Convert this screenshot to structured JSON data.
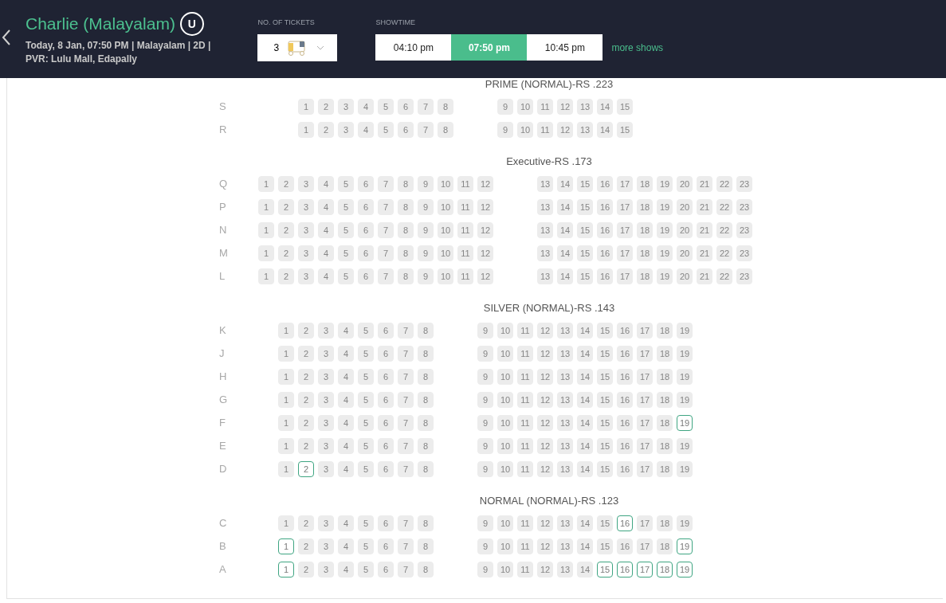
{
  "header": {
    "title": "Charlie (Malayalam)",
    "certificate": "U",
    "details_line1": "Today, 8 Jan, 07:50 PM | Malayalam | 2D |",
    "details_line2": "PVR: Lulu Mall, Edapally",
    "tickets": {
      "label": "NO. OF TICKETS",
      "value": "3"
    },
    "showtime": {
      "label": "SHOWTIME",
      "times": [
        {
          "label": "04:10 pm",
          "selected": false
        },
        {
          "label": "07:50 pm",
          "selected": true
        },
        {
          "label": "10:45 pm",
          "selected": false
        }
      ],
      "more_link": "more shows"
    }
  },
  "sections": [
    {
      "title": "PRIME (NORMAL)-RS .223",
      "rows": [
        {
          "label": "S",
          "blocks": [
            [
              {
                "n": "1",
                "available": false
              },
              {
                "n": "2",
                "available": false
              },
              {
                "n": "3",
                "available": false
              },
              {
                "n": "4",
                "available": false
              },
              {
                "n": "5",
                "available": false
              },
              {
                "n": "6",
                "available": false
              },
              {
                "n": "7",
                "available": false
              },
              {
                "n": "8",
                "available": false
              }
            ],
            [
              {
                "n": "9",
                "available": false
              },
              {
                "n": "10",
                "available": false
              },
              {
                "n": "11",
                "available": false
              },
              {
                "n": "12",
                "available": false
              },
              {
                "n": "13",
                "available": false
              },
              {
                "n": "14",
                "available": false
              },
              {
                "n": "15",
                "available": false
              }
            ]
          ]
        },
        {
          "label": "R",
          "blocks": [
            [
              {
                "n": "1",
                "available": false
              },
              {
                "n": "2",
                "available": false
              },
              {
                "n": "3",
                "available": false
              },
              {
                "n": "4",
                "available": false
              },
              {
                "n": "5",
                "available": false
              },
              {
                "n": "6",
                "available": false
              },
              {
                "n": "7",
                "available": false
              },
              {
                "n": "8",
                "available": false
              }
            ],
            [
              {
                "n": "9",
                "available": false
              },
              {
                "n": "10",
                "available": false
              },
              {
                "n": "11",
                "available": false
              },
              {
                "n": "12",
                "available": false
              },
              {
                "n": "13",
                "available": false
              },
              {
                "n": "14",
                "available": false
              },
              {
                "n": "15",
                "available": false
              }
            ]
          ]
        }
      ]
    },
    {
      "title": "Executive-RS .173",
      "rows": [
        {
          "label": "Q",
          "blocks": [
            [
              {
                "n": "1",
                "available": false
              },
              {
                "n": "2",
                "available": false
              },
              {
                "n": "3",
                "available": false
              },
              {
                "n": "4",
                "available": false
              },
              {
                "n": "5",
                "available": false
              },
              {
                "n": "6",
                "available": false
              },
              {
                "n": "7",
                "available": false
              },
              {
                "n": "8",
                "available": false
              },
              {
                "n": "9",
                "available": false
              },
              {
                "n": "10",
                "available": false
              },
              {
                "n": "11",
                "available": false
              },
              {
                "n": "12",
                "available": false
              }
            ],
            [
              {
                "n": "13",
                "available": false
              },
              {
                "n": "14",
                "available": false
              },
              {
                "n": "15",
                "available": false
              },
              {
                "n": "16",
                "available": false
              },
              {
                "n": "17",
                "available": false
              },
              {
                "n": "18",
                "available": false
              },
              {
                "n": "19",
                "available": false
              },
              {
                "n": "20",
                "available": false
              },
              {
                "n": "21",
                "available": false
              },
              {
                "n": "22",
                "available": false
              },
              {
                "n": "23",
                "available": false
              }
            ]
          ]
        },
        {
          "label": "P",
          "blocks": [
            [
              {
                "n": "1",
                "available": false
              },
              {
                "n": "2",
                "available": false
              },
              {
                "n": "3",
                "available": false
              },
              {
                "n": "4",
                "available": false
              },
              {
                "n": "5",
                "available": false
              },
              {
                "n": "6",
                "available": false
              },
              {
                "n": "7",
                "available": false
              },
              {
                "n": "8",
                "available": false
              },
              {
                "n": "9",
                "available": false
              },
              {
                "n": "10",
                "available": false
              },
              {
                "n": "11",
                "available": false
              },
              {
                "n": "12",
                "available": false
              }
            ],
            [
              {
                "n": "13",
                "available": false
              },
              {
                "n": "14",
                "available": false
              },
              {
                "n": "15",
                "available": false
              },
              {
                "n": "16",
                "available": false
              },
              {
                "n": "17",
                "available": false
              },
              {
                "n": "18",
                "available": false
              },
              {
                "n": "19",
                "available": false
              },
              {
                "n": "20",
                "available": false
              },
              {
                "n": "21",
                "available": false
              },
              {
                "n": "22",
                "available": false
              },
              {
                "n": "23",
                "available": false
              }
            ]
          ]
        },
        {
          "label": "N",
          "blocks": [
            [
              {
                "n": "1",
                "available": false
              },
              {
                "n": "2",
                "available": false
              },
              {
                "n": "3",
                "available": false
              },
              {
                "n": "4",
                "available": false
              },
              {
                "n": "5",
                "available": false
              },
              {
                "n": "6",
                "available": false
              },
              {
                "n": "7",
                "available": false
              },
              {
                "n": "8",
                "available": false
              },
              {
                "n": "9",
                "available": false
              },
              {
                "n": "10",
                "available": false
              },
              {
                "n": "11",
                "available": false
              },
              {
                "n": "12",
                "available": false
              }
            ],
            [
              {
                "n": "13",
                "available": false
              },
              {
                "n": "14",
                "available": false
              },
              {
                "n": "15",
                "available": false
              },
              {
                "n": "16",
                "available": false
              },
              {
                "n": "17",
                "available": false
              },
              {
                "n": "18",
                "available": false
              },
              {
                "n": "19",
                "available": false
              },
              {
                "n": "20",
                "available": false
              },
              {
                "n": "21",
                "available": false
              },
              {
                "n": "22",
                "available": false
              },
              {
                "n": "23",
                "available": false
              }
            ]
          ]
        },
        {
          "label": "M",
          "blocks": [
            [
              {
                "n": "1",
                "available": false
              },
              {
                "n": "2",
                "available": false
              },
              {
                "n": "3",
                "available": false
              },
              {
                "n": "4",
                "available": false
              },
              {
                "n": "5",
                "available": false
              },
              {
                "n": "6",
                "available": false
              },
              {
                "n": "7",
                "available": false
              },
              {
                "n": "8",
                "available": false
              },
              {
                "n": "9",
                "available": false
              },
              {
                "n": "10",
                "available": false
              },
              {
                "n": "11",
                "available": false
              },
              {
                "n": "12",
                "available": false
              }
            ],
            [
              {
                "n": "13",
                "available": false
              },
              {
                "n": "14",
                "available": false
              },
              {
                "n": "15",
                "available": false
              },
              {
                "n": "16",
                "available": false
              },
              {
                "n": "17",
                "available": false
              },
              {
                "n": "18",
                "available": false
              },
              {
                "n": "19",
                "available": false
              },
              {
                "n": "20",
                "available": false
              },
              {
                "n": "21",
                "available": false
              },
              {
                "n": "22",
                "available": false
              },
              {
                "n": "23",
                "available": false
              }
            ]
          ]
        },
        {
          "label": "L",
          "blocks": [
            [
              {
                "n": "1",
                "available": false
              },
              {
                "n": "2",
                "available": false
              },
              {
                "n": "3",
                "available": false
              },
              {
                "n": "4",
                "available": false
              },
              {
                "n": "5",
                "available": false
              },
              {
                "n": "6",
                "available": false
              },
              {
                "n": "7",
                "available": false
              },
              {
                "n": "8",
                "available": false
              },
              {
                "n": "9",
                "available": false
              },
              {
                "n": "10",
                "available": false
              },
              {
                "n": "11",
                "available": false
              },
              {
                "n": "12",
                "available": false
              }
            ],
            [
              {
                "n": "13",
                "available": false
              },
              {
                "n": "14",
                "available": false
              },
              {
                "n": "15",
                "available": false
              },
              {
                "n": "16",
                "available": false
              },
              {
                "n": "17",
                "available": false
              },
              {
                "n": "18",
                "available": false
              },
              {
                "n": "19",
                "available": false
              },
              {
                "n": "20",
                "available": false
              },
              {
                "n": "21",
                "available": false
              },
              {
                "n": "22",
                "available": false
              },
              {
                "n": "23",
                "available": false
              }
            ]
          ]
        }
      ]
    },
    {
      "title": "SILVER (NORMAL)-RS .143",
      "rows": [
        {
          "label": "K",
          "blocks": [
            [
              {
                "n": "1",
                "available": false
              },
              {
                "n": "2",
                "available": false
              },
              {
                "n": "3",
                "available": false
              },
              {
                "n": "4",
                "available": false
              },
              {
                "n": "5",
                "available": false
              },
              {
                "n": "6",
                "available": false
              },
              {
                "n": "7",
                "available": false
              },
              {
                "n": "8",
                "available": false
              }
            ],
            [
              {
                "n": "9",
                "available": false
              },
              {
                "n": "10",
                "available": false
              },
              {
                "n": "11",
                "available": false
              },
              {
                "n": "12",
                "available": false
              },
              {
                "n": "13",
                "available": false
              },
              {
                "n": "14",
                "available": false
              },
              {
                "n": "15",
                "available": false
              },
              {
                "n": "16",
                "available": false
              },
              {
                "n": "17",
                "available": false
              },
              {
                "n": "18",
                "available": false
              },
              {
                "n": "19",
                "available": false
              }
            ]
          ]
        },
        {
          "label": "J",
          "blocks": [
            [
              {
                "n": "1",
                "available": false
              },
              {
                "n": "2",
                "available": false
              },
              {
                "n": "3",
                "available": false
              },
              {
                "n": "4",
                "available": false
              },
              {
                "n": "5",
                "available": false
              },
              {
                "n": "6",
                "available": false
              },
              {
                "n": "7",
                "available": false
              },
              {
                "n": "8",
                "available": false
              }
            ],
            [
              {
                "n": "9",
                "available": false
              },
              {
                "n": "10",
                "available": false
              },
              {
                "n": "11",
                "available": false
              },
              {
                "n": "12",
                "available": false
              },
              {
                "n": "13",
                "available": false
              },
              {
                "n": "14",
                "available": false
              },
              {
                "n": "15",
                "available": false
              },
              {
                "n": "16",
                "available": false
              },
              {
                "n": "17",
                "available": false
              },
              {
                "n": "18",
                "available": false
              },
              {
                "n": "19",
                "available": false
              }
            ]
          ]
        },
        {
          "label": "H",
          "blocks": [
            [
              {
                "n": "1",
                "available": false
              },
              {
                "n": "2",
                "available": false
              },
              {
                "n": "3",
                "available": false
              },
              {
                "n": "4",
                "available": false
              },
              {
                "n": "5",
                "available": false
              },
              {
                "n": "6",
                "available": false
              },
              {
                "n": "7",
                "available": false
              },
              {
                "n": "8",
                "available": false
              }
            ],
            [
              {
                "n": "9",
                "available": false
              },
              {
                "n": "10",
                "available": false
              },
              {
                "n": "11",
                "available": false
              },
              {
                "n": "12",
                "available": false
              },
              {
                "n": "13",
                "available": false
              },
              {
                "n": "14",
                "available": false
              },
              {
                "n": "15",
                "available": false
              },
              {
                "n": "16",
                "available": false
              },
              {
                "n": "17",
                "available": false
              },
              {
                "n": "18",
                "available": false
              },
              {
                "n": "19",
                "available": false
              }
            ]
          ]
        },
        {
          "label": "G",
          "blocks": [
            [
              {
                "n": "1",
                "available": false
              },
              {
                "n": "2",
                "available": false
              },
              {
                "n": "3",
                "available": false
              },
              {
                "n": "4",
                "available": false
              },
              {
                "n": "5",
                "available": false
              },
              {
                "n": "6",
                "available": false
              },
              {
                "n": "7",
                "available": false
              },
              {
                "n": "8",
                "available": false
              }
            ],
            [
              {
                "n": "9",
                "available": false
              },
              {
                "n": "10",
                "available": false
              },
              {
                "n": "11",
                "available": false
              },
              {
                "n": "12",
                "available": false
              },
              {
                "n": "13",
                "available": false
              },
              {
                "n": "14",
                "available": false
              },
              {
                "n": "15",
                "available": false
              },
              {
                "n": "16",
                "available": false
              },
              {
                "n": "17",
                "available": false
              },
              {
                "n": "18",
                "available": false
              },
              {
                "n": "19",
                "available": false
              }
            ]
          ]
        },
        {
          "label": "F",
          "blocks": [
            [
              {
                "n": "1",
                "available": false
              },
              {
                "n": "2",
                "available": false
              },
              {
                "n": "3",
                "available": false
              },
              {
                "n": "4",
                "available": false
              },
              {
                "n": "5",
                "available": false
              },
              {
                "n": "6",
                "available": false
              },
              {
                "n": "7",
                "available": false
              },
              {
                "n": "8",
                "available": false
              }
            ],
            [
              {
                "n": "9",
                "available": false
              },
              {
                "n": "10",
                "available": false
              },
              {
                "n": "11",
                "available": false
              },
              {
                "n": "12",
                "available": false
              },
              {
                "n": "13",
                "available": false
              },
              {
                "n": "14",
                "available": false
              },
              {
                "n": "15",
                "available": false
              },
              {
                "n": "16",
                "available": false
              },
              {
                "n": "17",
                "available": false
              },
              {
                "n": "18",
                "available": false
              },
              {
                "n": "19",
                "available": true
              }
            ]
          ]
        },
        {
          "label": "E",
          "blocks": [
            [
              {
                "n": "1",
                "available": false
              },
              {
                "n": "2",
                "available": false
              },
              {
                "n": "3",
                "available": false
              },
              {
                "n": "4",
                "available": false
              },
              {
                "n": "5",
                "available": false
              },
              {
                "n": "6",
                "available": false
              },
              {
                "n": "7",
                "available": false
              },
              {
                "n": "8",
                "available": false
              }
            ],
            [
              {
                "n": "9",
                "available": false
              },
              {
                "n": "10",
                "available": false
              },
              {
                "n": "11",
                "available": false
              },
              {
                "n": "12",
                "available": false
              },
              {
                "n": "13",
                "available": false
              },
              {
                "n": "14",
                "available": false
              },
              {
                "n": "15",
                "available": false
              },
              {
                "n": "16",
                "available": false
              },
              {
                "n": "17",
                "available": false
              },
              {
                "n": "18",
                "available": false
              },
              {
                "n": "19",
                "available": false
              }
            ]
          ]
        },
        {
          "label": "D",
          "blocks": [
            [
              {
                "n": "1",
                "available": false
              },
              {
                "n": "2",
                "available": true
              },
              {
                "n": "3",
                "available": false
              },
              {
                "n": "4",
                "available": false
              },
              {
                "n": "5",
                "available": false
              },
              {
                "n": "6",
                "available": false
              },
              {
                "n": "7",
                "available": false
              },
              {
                "n": "8",
                "available": false
              }
            ],
            [
              {
                "n": "9",
                "available": false
              },
              {
                "n": "10",
                "available": false
              },
              {
                "n": "11",
                "available": false
              },
              {
                "n": "12",
                "available": false
              },
              {
                "n": "13",
                "available": false
              },
              {
                "n": "14",
                "available": false
              },
              {
                "n": "15",
                "available": false
              },
              {
                "n": "16",
                "available": false
              },
              {
                "n": "17",
                "available": false
              },
              {
                "n": "18",
                "available": false
              },
              {
                "n": "19",
                "available": false
              }
            ]
          ]
        }
      ]
    },
    {
      "title": "NORMAL (NORMAL)-RS .123",
      "rows": [
        {
          "label": "C",
          "blocks": [
            [
              {
                "n": "1",
                "available": false
              },
              {
                "n": "2",
                "available": false
              },
              {
                "n": "3",
                "available": false
              },
              {
                "n": "4",
                "available": false
              },
              {
                "n": "5",
                "available": false
              },
              {
                "n": "6",
                "available": false
              },
              {
                "n": "7",
                "available": false
              },
              {
                "n": "8",
                "available": false
              }
            ],
            [
              {
                "n": "9",
                "available": false
              },
              {
                "n": "10",
                "available": false
              },
              {
                "n": "11",
                "available": false
              },
              {
                "n": "12",
                "available": false
              },
              {
                "n": "13",
                "available": false
              },
              {
                "n": "14",
                "available": false
              },
              {
                "n": "15",
                "available": false
              },
              {
                "n": "16",
                "available": true
              },
              {
                "n": "17",
                "available": false
              },
              {
                "n": "18",
                "available": false
              },
              {
                "n": "19",
                "available": false
              }
            ]
          ]
        },
        {
          "label": "B",
          "blocks": [
            [
              {
                "n": "1",
                "available": true
              },
              {
                "n": "2",
                "available": false
              },
              {
                "n": "3",
                "available": false
              },
              {
                "n": "4",
                "available": false
              },
              {
                "n": "5",
                "available": false
              },
              {
                "n": "6",
                "available": false
              },
              {
                "n": "7",
                "available": false
              },
              {
                "n": "8",
                "available": false
              }
            ],
            [
              {
                "n": "9",
                "available": false
              },
              {
                "n": "10",
                "available": false
              },
              {
                "n": "11",
                "available": false
              },
              {
                "n": "12",
                "available": false
              },
              {
                "n": "13",
                "available": false
              },
              {
                "n": "14",
                "available": false
              },
              {
                "n": "15",
                "available": false
              },
              {
                "n": "16",
                "available": false
              },
              {
                "n": "17",
                "available": false
              },
              {
                "n": "18",
                "available": false
              },
              {
                "n": "19",
                "available": true
              }
            ]
          ]
        },
        {
          "label": "A",
          "blocks": [
            [
              {
                "n": "1",
                "available": true
              },
              {
                "n": "2",
                "available": false
              },
              {
                "n": "3",
                "available": false
              },
              {
                "n": "4",
                "available": false
              },
              {
                "n": "5",
                "available": false
              },
              {
                "n": "6",
                "available": false
              },
              {
                "n": "7",
                "available": false
              },
              {
                "n": "8",
                "available": false
              }
            ],
            [
              {
                "n": "9",
                "available": false
              },
              {
                "n": "10",
                "available": false
              },
              {
                "n": "11",
                "available": false
              },
              {
                "n": "12",
                "available": false
              },
              {
                "n": "13",
                "available": false
              },
              {
                "n": "14",
                "available": false
              },
              {
                "n": "15",
                "available": true
              },
              {
                "n": "16",
                "available": true
              },
              {
                "n": "17",
                "available": true
              },
              {
                "n": "18",
                "available": true
              },
              {
                "n": "19",
                "available": true
              }
            ]
          ]
        }
      ]
    }
  ]
}
